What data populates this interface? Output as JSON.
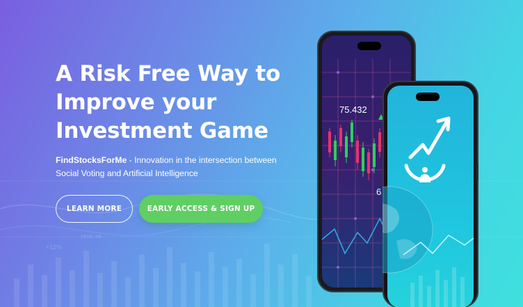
{
  "hero": {
    "headline": [
      "A Risk Free Way to",
      "Improve your",
      "Investment Game"
    ],
    "tagline_brand": "FindStocksForMe",
    "tagline_text": " - Innovation in the intersection between Social Voting and Artificial Intelligence",
    "buttons": {
      "learn_more": "LEARN MORE",
      "early_access": "EARLY ACCESS & SIGN UP"
    }
  },
  "background": {
    "faint_labels": [
      "+12%",
      "1010.50"
    ]
  },
  "phones": {
    "back_screen": {
      "price": "75.432",
      "partial_value": "6",
      "trend_icon": "up-triangle-icon"
    },
    "front_screen": {
      "logo_icon": "growth-arrow-person-icon",
      "globe_icon": "globe-icon"
    }
  },
  "colors": {
    "gradient_start": "#7a5fe0",
    "gradient_end": "#3fe0de",
    "early_access_button": "#5fcf63",
    "candle_up": "#2ecf5a",
    "candle_down": "#e8326e",
    "front_screen": "#1fb6d8"
  }
}
